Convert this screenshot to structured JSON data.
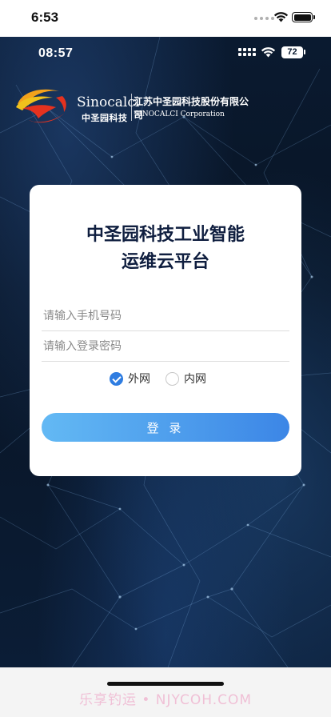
{
  "system_status": {
    "time": "6:53"
  },
  "app_status": {
    "time": "08:57",
    "battery": "72"
  },
  "logo": {
    "brand_en": "Sinocalci",
    "brand_cn": "中圣园科技",
    "company_cn": "江苏中圣园科技股份有限公司",
    "company_en": "SINOCALCI  Corporation"
  },
  "login": {
    "title_line1": "中圣园科技工业智能",
    "title_line2": "运维云平台",
    "phone_placeholder": "请输入手机号码",
    "password_placeholder": "请输入登录密码",
    "network_options": [
      {
        "label": "外网",
        "selected": true
      },
      {
        "label": "内网",
        "selected": false
      }
    ],
    "submit_label": "登 录"
  },
  "watermark": "乐享钓运 • NJYCOH.COM",
  "colors": {
    "accent": "#2f7de1",
    "button_gradient_start": "#63b9f4",
    "button_gradient_end": "#3c86e6",
    "title": "#0f1e3f",
    "background_dark": "#081424"
  }
}
